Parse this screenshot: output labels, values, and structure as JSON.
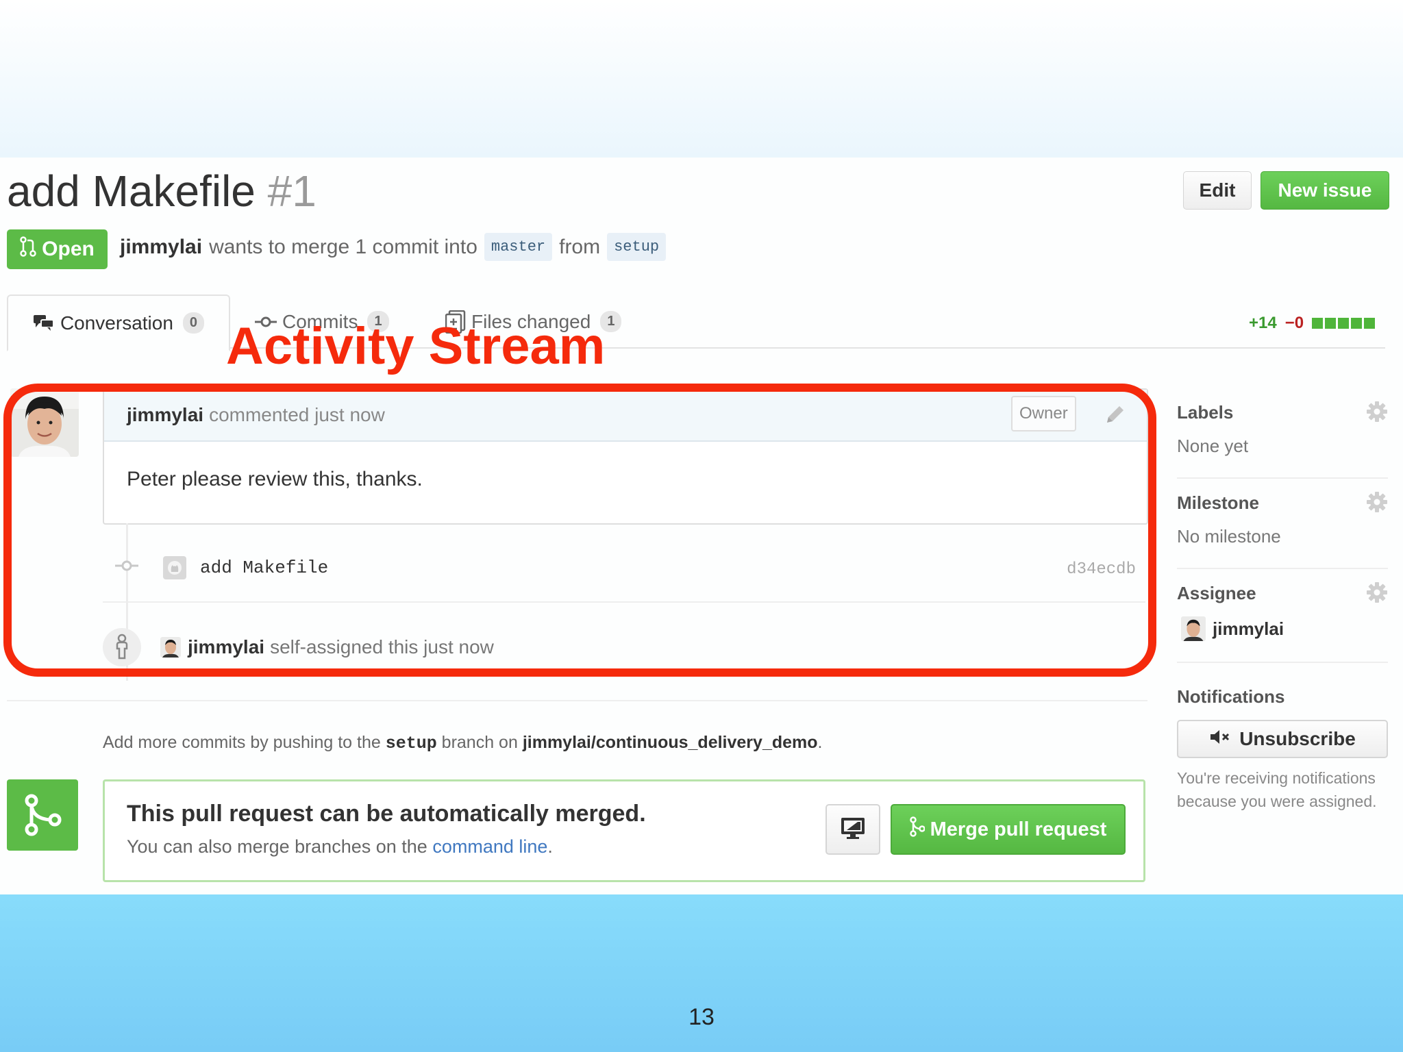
{
  "slide": {
    "heading": "",
    "page_number": "13"
  },
  "pr": {
    "title": "add Makefile",
    "number": "#1",
    "state": "Open",
    "author": "jimmylai",
    "merge_text": "wants to merge 1 commit into",
    "base_branch": "master",
    "from_text": "from",
    "head_branch": "setup"
  },
  "header_buttons": {
    "edit": "Edit",
    "new_issue": "New issue"
  },
  "tabs": [
    {
      "label": "Conversation",
      "count": "0",
      "icon": "comment-discussion-icon"
    },
    {
      "label": "Commits",
      "count": "1",
      "icon": "git-commit-icon"
    },
    {
      "label": "Files changed",
      "count": "1",
      "icon": "file-diff-icon"
    }
  ],
  "diffstat": {
    "additions": "+14",
    "deletions": "−0",
    "blocks": 5
  },
  "annotation": {
    "label": "Activity Stream",
    "color": "#f52a0c"
  },
  "comment": {
    "author": "jimmylai",
    "action": "commented just now",
    "badge": "Owner",
    "body": "Peter please review this, thanks."
  },
  "commit": {
    "message": "add Makefile",
    "sha": "d34ecdb"
  },
  "assign_event": {
    "user": "jimmylai",
    "text": "self-assigned this just now"
  },
  "push_note": {
    "prefix": "Add more commits by pushing to the",
    "branch": "setup",
    "middle": "branch on",
    "repo": "jimmylai/continuous_delivery_demo",
    "suffix": "."
  },
  "merge": {
    "title": "This pull request can be automatically merged.",
    "subtitle_prefix": "You can also merge branches on the",
    "link": "command line",
    "subtitle_suffix": ".",
    "button": "Merge pull request"
  },
  "sidebar": {
    "labels": {
      "title": "Labels",
      "value": "None yet"
    },
    "milestone": {
      "title": "Milestone",
      "value": "No milestone"
    },
    "assignee": {
      "title": "Assignee",
      "user": "jimmylai"
    },
    "notifications": {
      "title": "Notifications",
      "button": "Unsubscribe",
      "note_line1": "You're receiving notifications",
      "note_line2": "because you were assigned."
    }
  },
  "colors": {
    "green": "#5cbb47",
    "link": "#4078c0",
    "highlight": "#f52a0c"
  }
}
